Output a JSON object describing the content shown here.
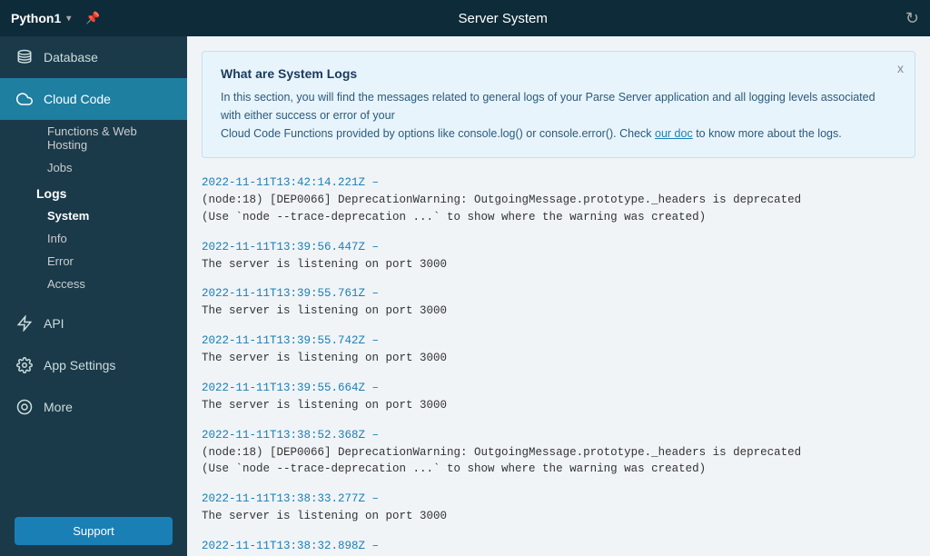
{
  "header": {
    "app_name": "Python1",
    "chevron": "▾",
    "pin_icon": "📌",
    "title": "Server System",
    "refresh_icon": "↻"
  },
  "sidebar": {
    "items": [
      {
        "id": "database",
        "label": "Database",
        "icon": "🗄"
      },
      {
        "id": "cloud-code",
        "label": "Cloud Code",
        "icon": "☁",
        "active": true
      }
    ],
    "cloud_code_sub": {
      "functions": "Functions & Web Hosting",
      "jobs": "Jobs",
      "logs_label": "Logs",
      "logs_sub": [
        {
          "id": "system",
          "label": "System",
          "active": true
        },
        {
          "id": "info",
          "label": "Info"
        },
        {
          "id": "error",
          "label": "Error"
        },
        {
          "id": "access",
          "label": "Access"
        }
      ]
    },
    "other_items": [
      {
        "id": "api",
        "label": "API",
        "icon": "⚡"
      },
      {
        "id": "app-settings",
        "label": "App Settings",
        "icon": "⚙"
      },
      {
        "id": "more",
        "label": "More",
        "icon": "◎"
      }
    ],
    "support_label": "Support"
  },
  "main": {
    "info_box": {
      "title": "What are System Logs",
      "text1": "In this section, you will find the messages related to general logs of your Parse Server application and all logging levels associated with either success or error of your",
      "text2": "Cloud Code Functions provided by options like console.log() or console.error(). Check ",
      "link_text": "our doc",
      "text3": " to know more about the logs.",
      "close_label": "x"
    },
    "log_entries": [
      {
        "timestamp": "2022-11-11T13:42:14.221Z –",
        "messages": [
          "(node:18) [DEP0066] DeprecationWarning: OutgoingMessage.prototype._headers is deprecated",
          "(Use `node --trace-deprecation ...` to show where the warning was created)"
        ]
      },
      {
        "timestamp": "2022-11-11T13:39:56.447Z –",
        "messages": [
          "The server is listening on port 3000"
        ]
      },
      {
        "timestamp": "2022-11-11T13:39:55.761Z –",
        "messages": [
          "The server is listening on port 3000"
        ]
      },
      {
        "timestamp": "2022-11-11T13:39:55.742Z –",
        "messages": [
          "The server is listening on port 3000"
        ]
      },
      {
        "timestamp": "2022-11-11T13:39:55.664Z –",
        "messages": [
          "The server is listening on port 3000"
        ]
      },
      {
        "timestamp": "2022-11-11T13:38:52.368Z –",
        "messages": [
          "(node:18) [DEP0066] DeprecationWarning: OutgoingMessage.prototype._headers is deprecated",
          "(Use `node --trace-deprecation ...` to show where the warning was created)"
        ]
      },
      {
        "timestamp": "2022-11-11T13:38:33.277Z –",
        "messages": [
          "The server is listening on port 3000"
        ]
      },
      {
        "timestamp": "2022-11-11T13:38:32.898Z –",
        "messages": []
      }
    ]
  }
}
